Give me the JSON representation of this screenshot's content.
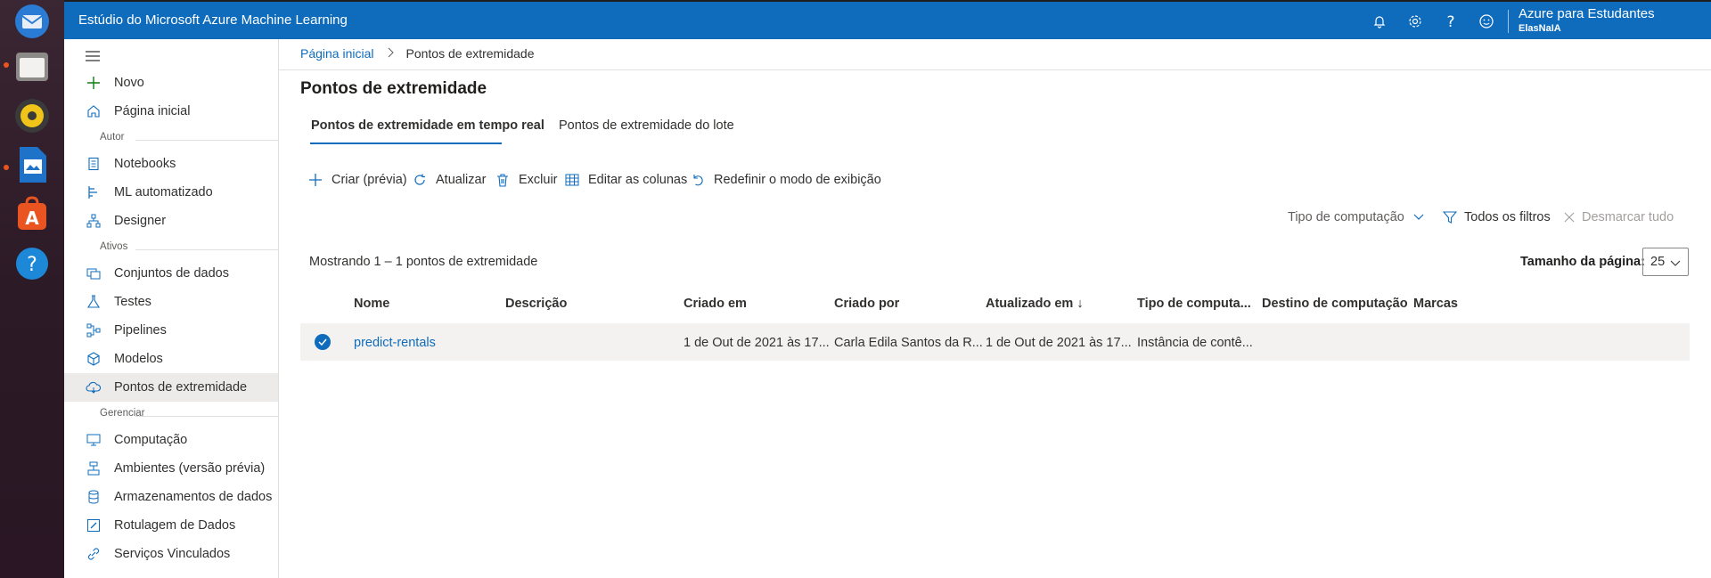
{
  "app": {
    "title": "Estúdio do Microsoft Azure Machine Learning",
    "account_name": "Azure para Estudantes",
    "account_sub": "ElasNaIA"
  },
  "dock": {
    "items": [
      "thunderbird-icon",
      "files-icon",
      "rhythmbox-icon",
      "writer-icon",
      "software-center-icon",
      "help-icon"
    ]
  },
  "sidebar": {
    "new_label": "Novo",
    "home_label": "Página inicial",
    "section_autor": "Autor",
    "notebooks": "Notebooks",
    "automl": "ML automatizado",
    "designer": "Designer",
    "section_ativos": "Ativos",
    "datasets": "Conjuntos de dados",
    "experiments": "Testes",
    "pipelines": "Pipelines",
    "models": "Modelos",
    "endpoints": "Pontos de extremidade",
    "section_gerenciar": "Gerenciar",
    "compute": "Computação",
    "environments": "Ambientes (versão prévia)",
    "datastores": "Armazenamentos de dados",
    "labeling": "Rotulagem de Dados",
    "linked": "Serviços Vinculados"
  },
  "breadcrumb": {
    "home": "Página inicial",
    "current": "Pontos de extremidade"
  },
  "page": {
    "title": "Pontos de extremidade",
    "tab_realtime": "Pontos de extremidade em tempo real",
    "tab_batch": "Pontos de extremidade do lote"
  },
  "toolbar": {
    "create": "Criar (prévia)",
    "refresh": "Atualizar",
    "delete": "Excluir",
    "edit_columns": "Editar as colunas",
    "reset_view": "Redefinir o modo de exibição"
  },
  "filters": {
    "compute_type": "Tipo de computação",
    "all_filters": "Todos os filtros",
    "clear_all": "Desmarcar tudo"
  },
  "list": {
    "showing": "Mostrando 1 – 1 pontos de extremidade",
    "page_size_label": "Tamanho da página:",
    "page_size_value": "25",
    "columns": {
      "name": "Nome",
      "description": "Descrição",
      "created_on": "Criado em",
      "created_by": "Criado por",
      "updated_on": "Atualizado em ↓",
      "compute_type": "Tipo de computa...",
      "compute_target": "Destino de computação",
      "tags": "Marcas"
    },
    "rows": [
      {
        "name": "predict-rentals",
        "description": "",
        "created_on": "1 de Out de 2021 às 17...",
        "created_by": "Carla Edila Santos da R...",
        "updated_on": "1 de Out de 2021 às 17...",
        "compute_type": "Instância de contê...",
        "compute_target": "",
        "tags": ""
      }
    ]
  },
  "colors": {
    "brand": "#0f6cbd",
    "selected_row": "#f3f2f1"
  }
}
